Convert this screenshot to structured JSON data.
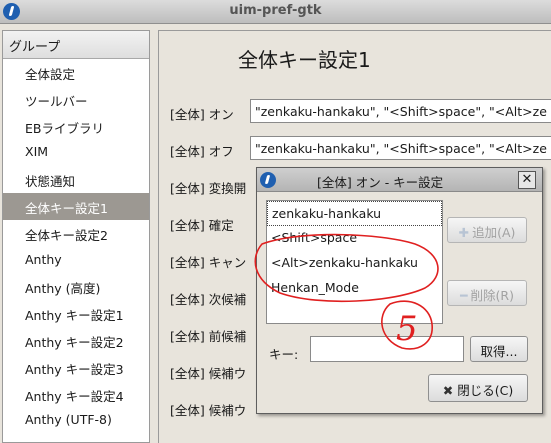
{
  "window": {
    "title": "uim-pref-gtk"
  },
  "sidebar": {
    "header": "グループ",
    "items": [
      {
        "label": "全体設定"
      },
      {
        "label": "ツールバー"
      },
      {
        "label": "EBライブラリ"
      },
      {
        "label": "XIM"
      },
      {
        "label": "状態通知"
      },
      {
        "label": "全体キー設定1",
        "selected": true
      },
      {
        "label": "全体キー設定2"
      },
      {
        "label": "Anthy"
      },
      {
        "label": "Anthy (高度)"
      },
      {
        "label": "Anthy キー設定1"
      },
      {
        "label": "Anthy キー設定2"
      },
      {
        "label": "Anthy キー設定3"
      },
      {
        "label": "Anthy キー設定4"
      },
      {
        "label": "Anthy (UTF-8)"
      }
    ]
  },
  "main": {
    "page_title": "全体キー設定1",
    "rows": [
      {
        "label": "[全体] オン",
        "value": "\"zenkaku-hankaku\", \"<Shift>space\", \"<Alt>ze"
      },
      {
        "label": "[全体] オフ",
        "value": "\"zenkaku-hankaku\", \"<Shift>space\", \"<Alt>ze"
      },
      {
        "label": "[全体] 変換開",
        "value": ""
      },
      {
        "label": "[全体] 確定",
        "value": ""
      },
      {
        "label": "[全体] キャン",
        "value": ""
      },
      {
        "label": "[全体] 次候補",
        "value": ""
      },
      {
        "label": "[全体] 前候補",
        "value": ""
      },
      {
        "label": "[全体] 候補ウ",
        "value": ""
      },
      {
        "label": "[全体] 候補ウ",
        "value": ""
      }
    ]
  },
  "dialog": {
    "title": "[全体] オン - キー設定",
    "keys": [
      "zenkaku-hankaku",
      "<Shift>space",
      "<Alt>zenkaku-hankaku",
      "Henkan_Mode"
    ],
    "add_label": "追加(A)",
    "remove_label": "削除(R)",
    "key_label": "キー:",
    "key_value": "",
    "capture_label": "取得...",
    "close_label": "閉じる(C)"
  },
  "annotation": {
    "text": "5",
    "color": "#e02020"
  }
}
